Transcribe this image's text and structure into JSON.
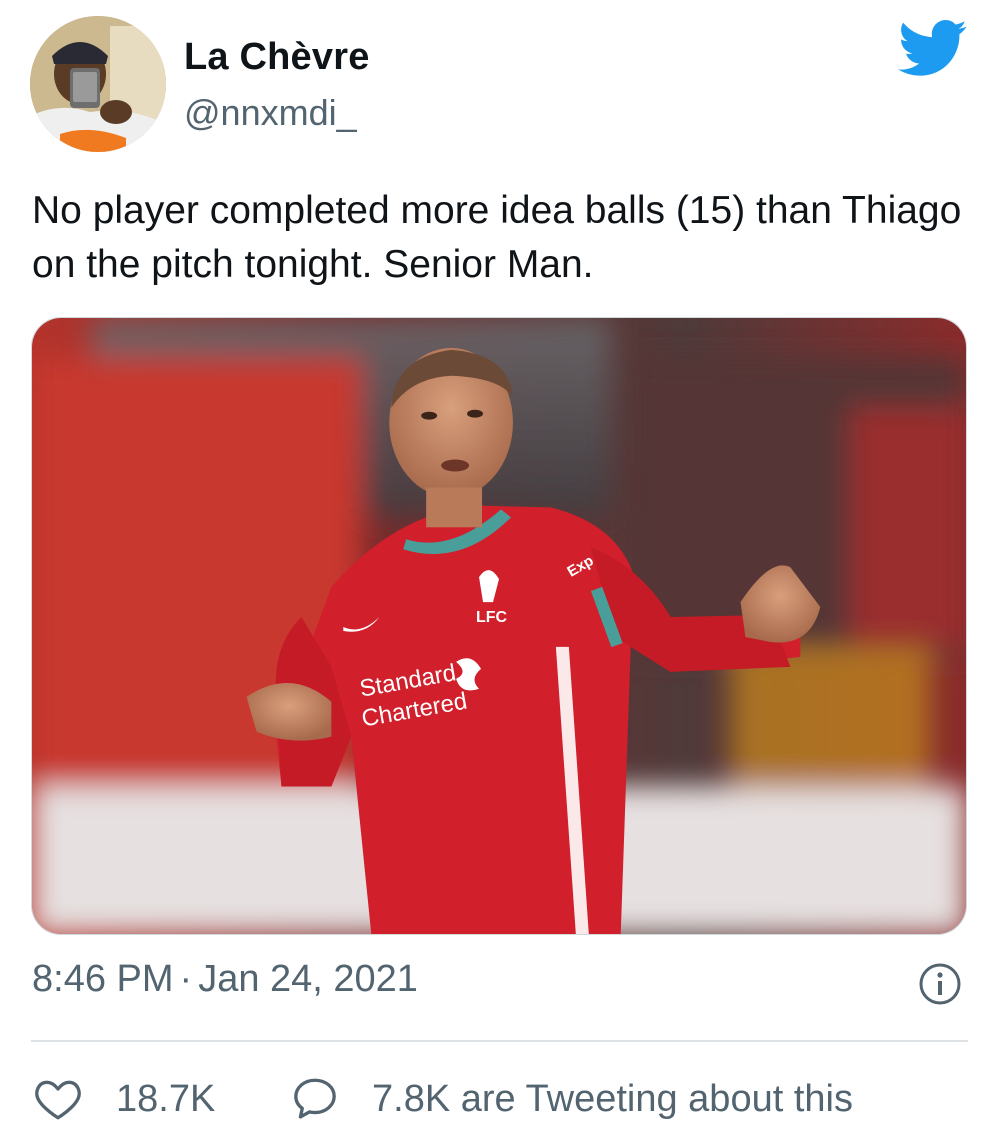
{
  "author": {
    "display_name": "La Chèvre",
    "handle": "@nnxmdi_",
    "avatar_icon": "profile-photo"
  },
  "brand": {
    "logo": "twitter-bird-icon",
    "color": "#1D9BF0"
  },
  "tweet": {
    "text": "No player completed more idea balls (15) than Thiago on the pitch tonight. Senior Man."
  },
  "media": {
    "shirt_crest": "LFC",
    "shirt_sponsor_line1": "Standard",
    "shirt_sponsor_line2": "Chartered",
    "sleeve_text": "Exp"
  },
  "meta": {
    "time": "8:46 PM",
    "separator": "·",
    "date": "Jan 24, 2021",
    "info_icon": "info-icon"
  },
  "actions": {
    "like_icon": "heart-icon",
    "like_count": "18.7K",
    "reply_icon": "speech-bubble-icon",
    "reply_text": "7.8K are Tweeting about this"
  },
  "colors": {
    "text_primary": "#0F1419",
    "text_secondary": "#536471",
    "divider": "#DCE2E6",
    "jersey_red": "#D11F2B"
  }
}
